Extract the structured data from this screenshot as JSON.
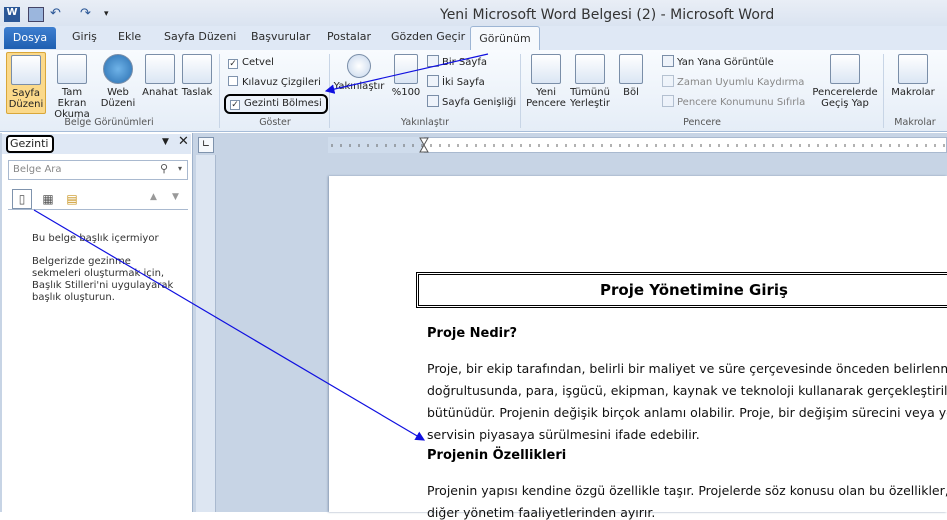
{
  "window": {
    "title": "Yeni Microsoft Word Belgesi (2) - Microsoft Word"
  },
  "tabs": {
    "file": "Dosya",
    "items": [
      "Giriş",
      "Ekle",
      "Sayfa Düzeni",
      "Başvurular",
      "Postalar",
      "Gözden Geçir"
    ],
    "active": "Görünüm"
  },
  "ribbon": {
    "belge": {
      "label": "Belge Görünümleri",
      "buttons": [
        "Sayfa Düzeni",
        "Tam Ekran Okuma",
        "Web Düzeni",
        "Anahat",
        "Taslak"
      ]
    },
    "goster": {
      "label": "Göster",
      "cetvel": "Cetvel",
      "kilavuz": "Kılavuz Çizgileri",
      "gezinti": "Gezinti Bölmesi"
    },
    "yakinlastir": {
      "label": "Yakınlaştır",
      "zoom": "Yakınlaştır",
      "percent": "%100",
      "bir_sayfa": "Bir Sayfa",
      "iki_sayfa": "İki Sayfa",
      "sayfa_genisligi": "Sayfa Genişliği"
    },
    "pencere": {
      "label": "Pencere",
      "yeni": "Yeni Pencere",
      "tumunu": "Tümünü Yerleştir",
      "bol": "Böl",
      "yan_yana": "Yan Yana Görüntüle",
      "zaman_uyumlu": "Zaman Uyumlu Kaydırma",
      "konum": "Pencere Konumunu Sıfırla",
      "gecis": "Pencerelerde Geçiş Yap"
    },
    "makrolar": {
      "label": "Makrolar",
      "button": "Makrolar"
    }
  },
  "nav": {
    "title": "Gezinti",
    "search_placeholder": "Belge Ara",
    "msg1": "Bu belge başlık içermiyor",
    "msg2": "Belgerizde gezinme sekmeleri oluşturmak için, Başlık Stilleri'ni uygulayarak başlık oluşturun."
  },
  "document": {
    "title": "Proje Yönetimine Giriş",
    "h1": "Proje Nedir?",
    "p1": [
      "Proje, bir ekip tarafından, belirli bir maliyet ve süre çerçevesinde önceden belirlenmiş",
      "doğrultusunda, para, işgücü, ekipman, kaynak ve teknoloji kullanarak gerçekleştirilen",
      "bütünüdür. Projenin değişik birçok anlamı olabilir. Proje, bir değişim sürecini veya yen",
      "servisin piyasaya sürülmesini ifade edebilir."
    ],
    "h2": "Projenin Özellikleri",
    "p2": [
      "Projenin yapısı kendine özgü özellikle taşır. Projelerde söz konusu olan bu özellikler, p",
      "diğer yönetim faaliyetlerinden ayırır."
    ]
  },
  "colors": {
    "accent": "#2b5797",
    "annotation": "#1010e0"
  }
}
